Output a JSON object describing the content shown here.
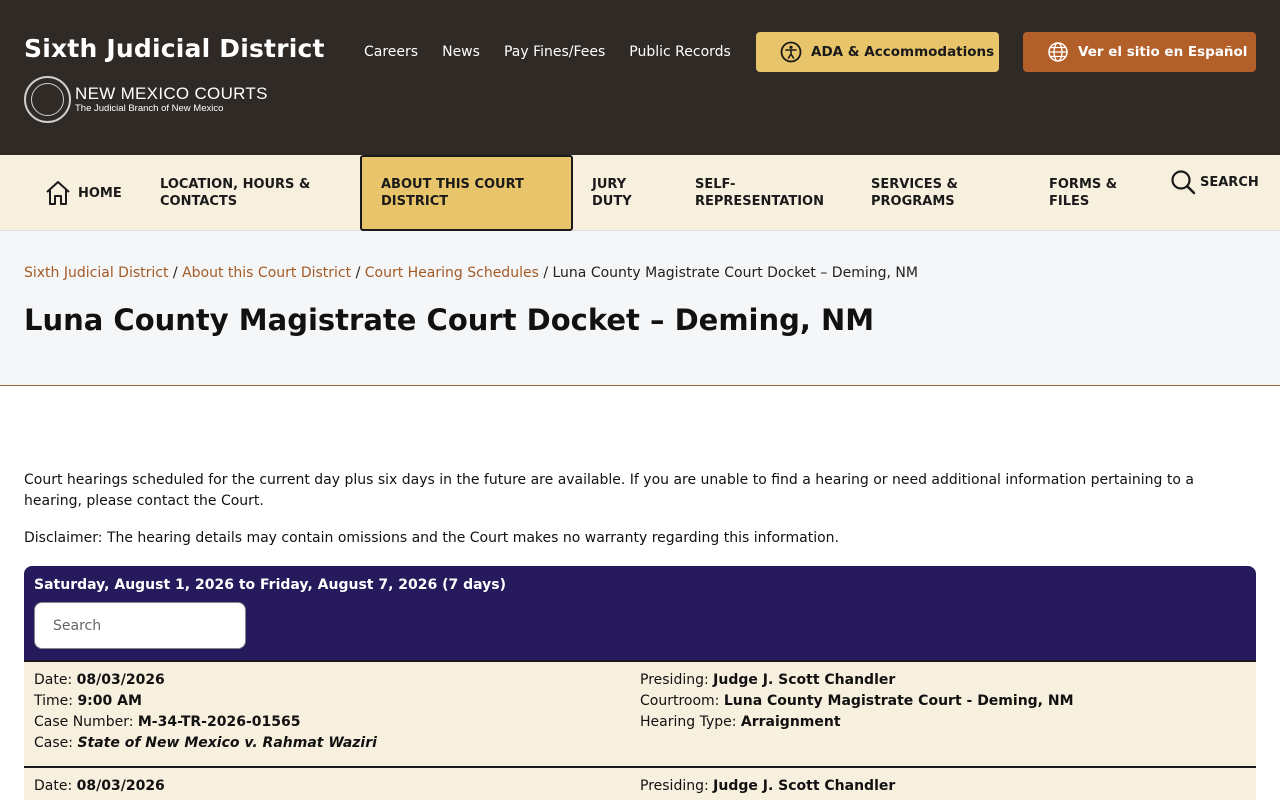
{
  "header": {
    "site_title": "Sixth Judicial District",
    "logo_main": "NEW MEXICO COURTS",
    "logo_sub": "The Judicial Branch of New Mexico",
    "util_links": [
      "Careers",
      "News",
      "Pay Fines/Fees",
      "Public Records"
    ],
    "ada_label": "ADA & Accommodations",
    "spanish_label": "Ver el sitio en Español"
  },
  "nav": {
    "home": "HOME",
    "location_l1": "LOCATION, HOURS &",
    "location_l2": "CONTACTS",
    "about_l1": "ABOUT THIS COURT",
    "about_l2": "DISTRICT",
    "jury_l1": "JURY",
    "jury_l2": "DUTY",
    "selfrep_l1": "SELF-",
    "selfrep_l2": "REPRESENTATION",
    "services_l1": "SERVICES &",
    "services_l2": "PROGRAMS",
    "forms_l1": "FORMS &",
    "forms_l2": "FILES",
    "search": "SEARCH"
  },
  "breadcrumb": {
    "items": [
      "Sixth Judicial District",
      "About this Court District",
      "Court Hearing Schedules"
    ],
    "current": "Luna County Magistrate Court Docket – Deming, NM",
    "separator": " / "
  },
  "page_title": "Luna County Magistrate Court Docket – Deming, NM",
  "intro": "Court hearings scheduled for the current day plus six days in the future are available. If you are unable to find a hearing or need additional information pertaining to a hearing, please contact the Court.",
  "disclaimer": "Disclaimer:  The hearing details may contain omissions and the Court makes no warranty regarding this information.",
  "docket": {
    "range": "Saturday, August 1, 2026 to Friday, August 7, 2026 (7 days)",
    "search_placeholder": "Search",
    "labels": {
      "date": "Date: ",
      "time": "Time: ",
      "case_number": "Case Number: ",
      "case": "Case: ",
      "presiding": "Presiding: ",
      "courtroom": "Courtroom: ",
      "hearing_type": "Hearing Type: "
    },
    "entries": [
      {
        "date": "08/03/2026",
        "time": "9:00 AM",
        "case_number": "M-34-TR-2026-01565",
        "case": "State of New Mexico v. Rahmat Waziri",
        "presiding": "Judge J. Scott Chandler",
        "courtroom": "Luna County Magistrate Court - Deming, NM",
        "hearing_type": "Arraignment"
      },
      {
        "date": "08/03/2026",
        "presiding": "Judge J. Scott Chandler"
      }
    ]
  }
}
